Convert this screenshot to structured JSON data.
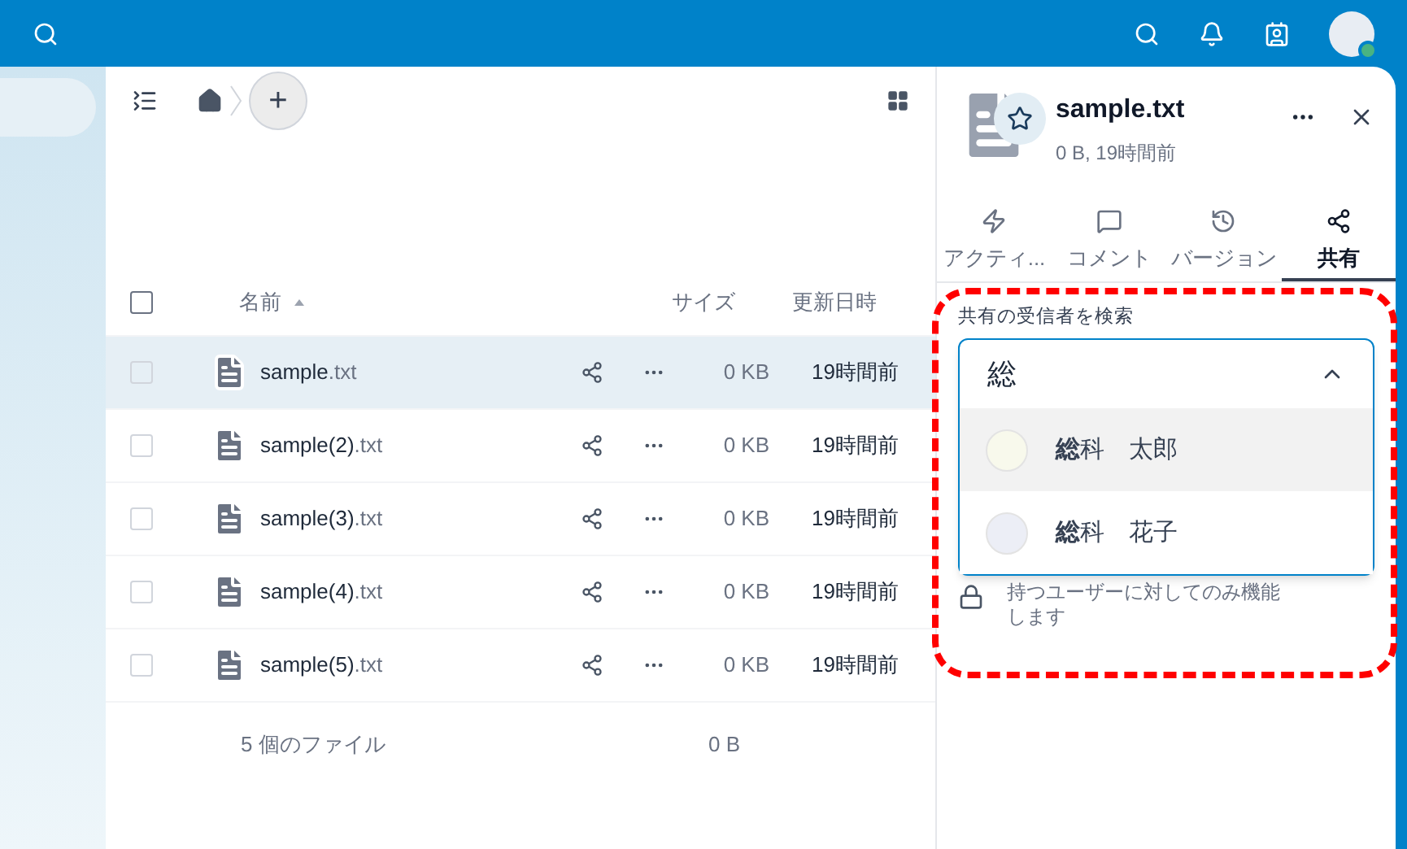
{
  "breadcrumb": {
    "new_button": "+"
  },
  "file_list": {
    "select_all_checked": false,
    "columns": {
      "name": "名前",
      "size": "サイズ",
      "modified": "更新日時"
    },
    "rows": [
      {
        "base": "sample",
        "ext": ".txt",
        "size": "0 KB",
        "modified": "19時間前",
        "selected": true
      },
      {
        "base": "sample(2)",
        "ext": ".txt",
        "size": "0 KB",
        "modified": "19時間前",
        "selected": false
      },
      {
        "base": "sample(3)",
        "ext": ".txt",
        "size": "0 KB",
        "modified": "19時間前",
        "selected": false
      },
      {
        "base": "sample(4)",
        "ext": ".txt",
        "size": "0 KB",
        "modified": "19時間前",
        "selected": false
      },
      {
        "base": "sample(5)",
        "ext": ".txt",
        "size": "0 KB",
        "modified": "19時間前",
        "selected": false
      }
    ],
    "summary": {
      "count": "5 個のファイル",
      "size": "0 B"
    }
  },
  "details": {
    "title": "sample.txt",
    "subtitle": "0 B, 19時間前",
    "tabs": [
      {
        "kind": "activity",
        "label": "アクティ...",
        "selected": false
      },
      {
        "kind": "comments",
        "label": "コメント",
        "selected": false
      },
      {
        "kind": "versions",
        "label": "バージョン",
        "selected": false
      },
      {
        "kind": "sharing",
        "label": "共有",
        "selected": true
      }
    ],
    "search_label": "共有の受信者を検索",
    "search_value": "総",
    "suggestions": [
      {
        "name": "**総**科　太郎",
        "color": "#f8f9ec",
        "selected": true
      },
      {
        "name": "**総**科　花子",
        "color": "#eceef6",
        "selected": false
      }
    ],
    "note_lines": [
      "持つユーザーに対してのみ機能",
      "します"
    ]
  }
}
